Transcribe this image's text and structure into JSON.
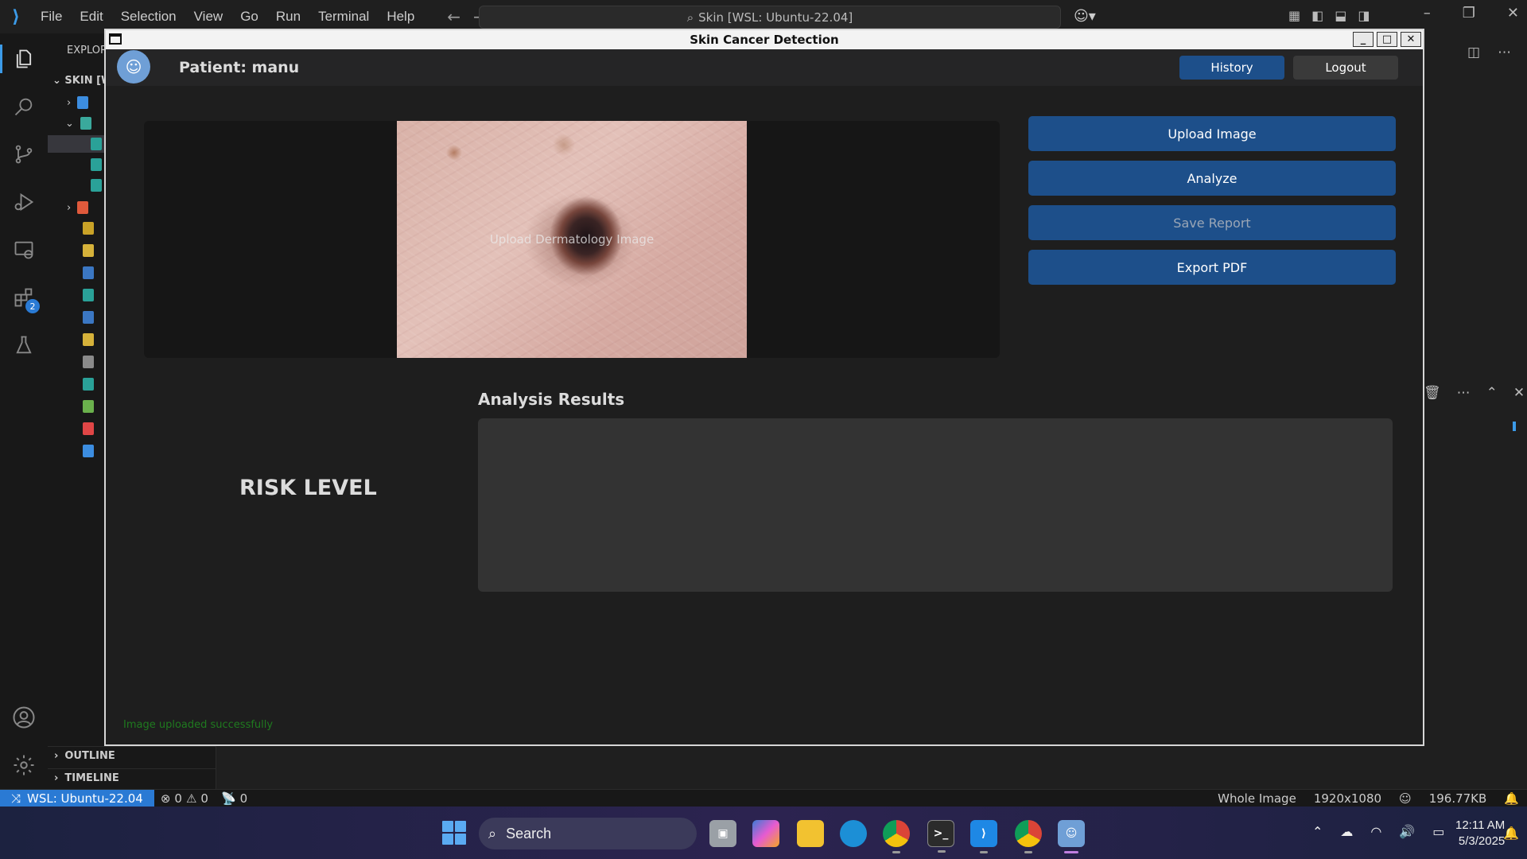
{
  "vscode": {
    "menu": [
      "File",
      "Edit",
      "Selection",
      "View",
      "Go",
      "Run",
      "Terminal",
      "Help"
    ],
    "command_center": "Skin [WSL: Ubuntu-22.04]",
    "explorer_title": "EXPLOR",
    "explorer_root": "SKIN [W",
    "extensions_badge": "2",
    "outline_label": "OUTLINE",
    "timeline_label": "TIMELINE"
  },
  "statusbar": {
    "remote": "WSL: Ubuntu-22.04",
    "errors": "0",
    "warnings": "0",
    "ports": "0",
    "view_mode": "Whole Image",
    "resolution": "1920x1080",
    "file_size": "196.77KB"
  },
  "app": {
    "window_title": "Skin Cancer Detection",
    "patient_label": "Patient: manu",
    "history_button": "History",
    "logout_button": "Logout",
    "image_placeholder": "Upload Dermatology Image",
    "actions": {
      "upload": "Upload Image",
      "analyze": "Analyze",
      "save_report": "Save Report",
      "export_pdf": "Export PDF"
    },
    "results_title": "Analysis Results",
    "results_text": "",
    "risk_level": "RISK LEVEL",
    "status_message": "Image uploaded successfully"
  },
  "taskbar": {
    "search_label": "Search",
    "time": "12:11 AM",
    "date": "5/3/2025"
  },
  "colors": {
    "vs_accent": "#2a7ad4",
    "app_button": "#1d4f8a",
    "status_success": "#1f7a1f"
  }
}
